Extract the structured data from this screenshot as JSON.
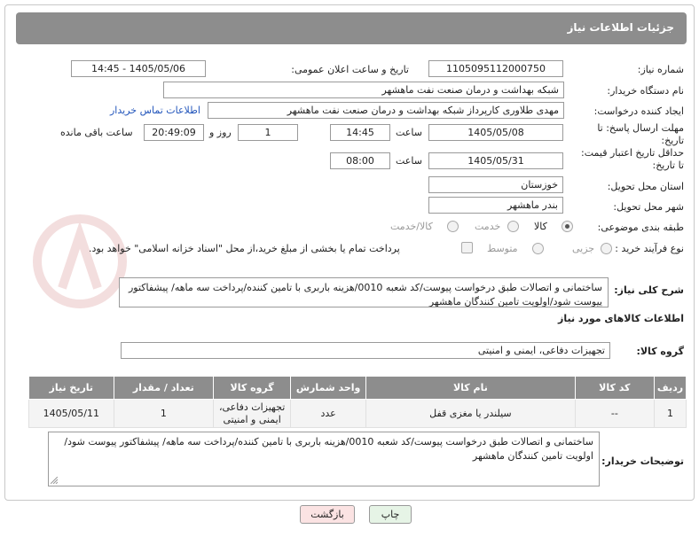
{
  "header": {
    "title": "جزئیات اطلاعات نیاز"
  },
  "fields": {
    "need_number": {
      "label": "شماره نیاز:",
      "value": "1105095112000750"
    },
    "announce_datetime": {
      "label": "تاریخ و ساعت اعلان عمومی:",
      "value": "1405/05/06 - 14:45"
    },
    "buyer_org": {
      "label": "نام دستگاه خریدار:",
      "value": "شبکه بهداشت و درمان صنعت نفت ماهشهر"
    },
    "requester": {
      "label": "ایجاد کننده درخواست:",
      "value": "مهدی طلاوری کارپرداز شبکه بهداشت و درمان صنعت نفت ماهشهر",
      "contact_link": "اطلاعات تماس خریدار"
    },
    "reply_deadline": {
      "label_line1": "مهلت ارسال پاسخ: تا",
      "label_line2": "تاریخ:",
      "date": "1405/05/08",
      "time_label": "ساعت",
      "time": "14:45",
      "days": "1",
      "days_label": "روز و",
      "remaining": "20:49:09",
      "remaining_label": "ساعت باقی مانده"
    },
    "price_validity": {
      "label_line1": "حداقل تاریخ اعتبار قیمت:",
      "label_line2": "تا تاریخ:",
      "date": "1405/05/31",
      "time_label": "ساعت",
      "time": "08:00"
    },
    "delivery_province": {
      "label": "استان محل تحویل:",
      "value": "خوزستان"
    },
    "delivery_city": {
      "label": "شهر محل تحویل:",
      "value": "بندر ماهشهر"
    },
    "category": {
      "label": "طبقه بندی موضوعی:",
      "options": [
        "کالا",
        "خدمت",
        "کالا/خدمت"
      ],
      "selected": "کالا"
    },
    "process_type": {
      "label": "نوع فرآیند خرید :",
      "options": [
        "جزیی",
        "متوسط"
      ],
      "selected": "جزیی",
      "payment_note": "پرداخت تمام یا بخشی از مبلغ خرید،از محل \"اسناد خزانه اسلامی\" خواهد بود."
    },
    "general_desc": {
      "label": "شرح کلی نیاز:",
      "value": "ساختمانی و اتصالات طبق درخواست پیوست/کد شعبه 0010/هزینه باربری با تامین کننده/پرداخت سه ماهه/ پیشفاکتور پیوست شود/اولویت تامین کنندگان ماهشهر"
    }
  },
  "goods_info": {
    "section_title": "اطلاعات کالاهای مورد نیاز",
    "group_label": "گروه کالا:",
    "group_value": "تجهیزات دفاعی، ایمنی و امنیتی",
    "table": {
      "headers": [
        "ردیف",
        "کد کالا",
        "نام کالا",
        "واحد شمارش",
        "گروه کالا",
        "تعداد / مقدار",
        "تاریخ نیاز"
      ],
      "rows": [
        [
          "1",
          "--",
          "سیلندر یا مغزی قفل",
          "عدد",
          "تجهیزات دفاعی، ایمنی و امنیتی",
          "1",
          "1405/05/11"
        ]
      ]
    }
  },
  "buyer_notes": {
    "label": "توضیحات خریدار:",
    "value": "ساختمانی و اتصالات طبق درخواست پیوست/کد شعبه 0010/هزینه باربری با تامین کننده/پرداخت سه ماهه/ پیشفاکتور پیوست شود/اولویت تامین کنندگان ماهشهر"
  },
  "buttons": {
    "print": "چاپ",
    "back": "بازگشت"
  },
  "colors": {
    "header_bg": "#8d8d8d",
    "back_btn_bg": "#fbe3e3",
    "print_btn_bg": "#e6f4e6",
    "link": "#2255bb"
  }
}
